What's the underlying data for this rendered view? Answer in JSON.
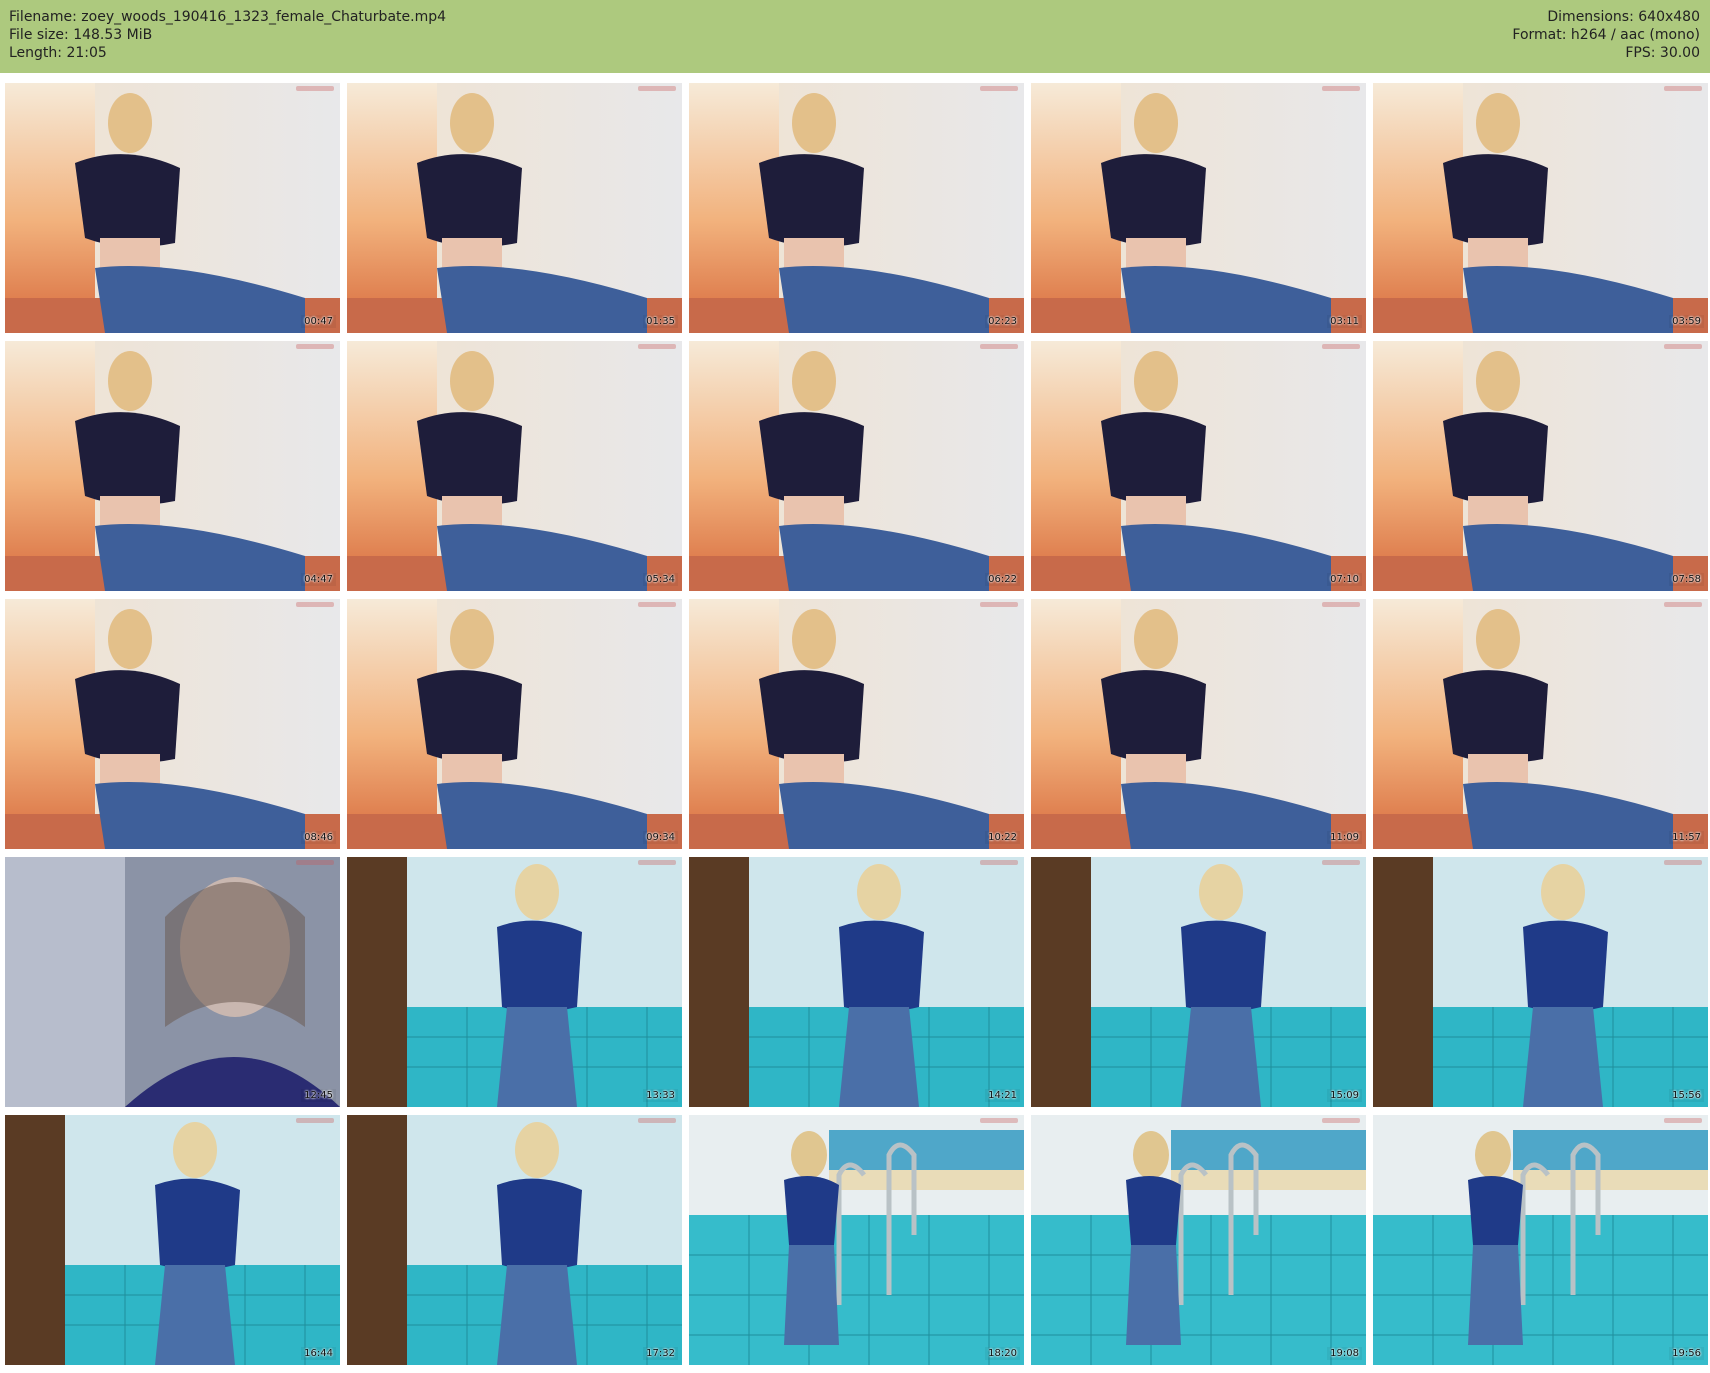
{
  "header": {
    "filename": "Filename: zoey_woods_190416_1323_female_Chaturbate.mp4",
    "filesize": "File size: 148.53 MiB",
    "length": "Length: 21:05",
    "dimensions": "Dimensions: 640x480",
    "format": "Format: h264 / aac (mono)",
    "fps": "FPS: 30.00"
  },
  "thumbnails": [
    {
      "time": "00:47",
      "scene": "room"
    },
    {
      "time": "01:35",
      "scene": "room"
    },
    {
      "time": "02:23",
      "scene": "room"
    },
    {
      "time": "03:11",
      "scene": "room"
    },
    {
      "time": "03:59",
      "scene": "room"
    },
    {
      "time": "04:47",
      "scene": "room"
    },
    {
      "time": "05:34",
      "scene": "room"
    },
    {
      "time": "06:22",
      "scene": "room"
    },
    {
      "time": "07:10",
      "scene": "room"
    },
    {
      "time": "07:58",
      "scene": "room"
    },
    {
      "time": "08:46",
      "scene": "room"
    },
    {
      "time": "09:34",
      "scene": "room"
    },
    {
      "time": "10:22",
      "scene": "room"
    },
    {
      "time": "11:09",
      "scene": "room"
    },
    {
      "time": "11:57",
      "scene": "room"
    },
    {
      "time": "12:45",
      "scene": "closeup"
    },
    {
      "time": "13:33",
      "scene": "pool-door"
    },
    {
      "time": "14:21",
      "scene": "pool-door"
    },
    {
      "time": "15:09",
      "scene": "pool-door"
    },
    {
      "time": "15:56",
      "scene": "pool-door"
    },
    {
      "time": "16:44",
      "scene": "pool-door"
    },
    {
      "time": "17:32",
      "scene": "pool-door"
    },
    {
      "time": "18:20",
      "scene": "pool-ladder"
    },
    {
      "time": "19:08",
      "scene": "pool-ladder"
    },
    {
      "time": "19:56",
      "scene": "pool-ladder"
    }
  ]
}
